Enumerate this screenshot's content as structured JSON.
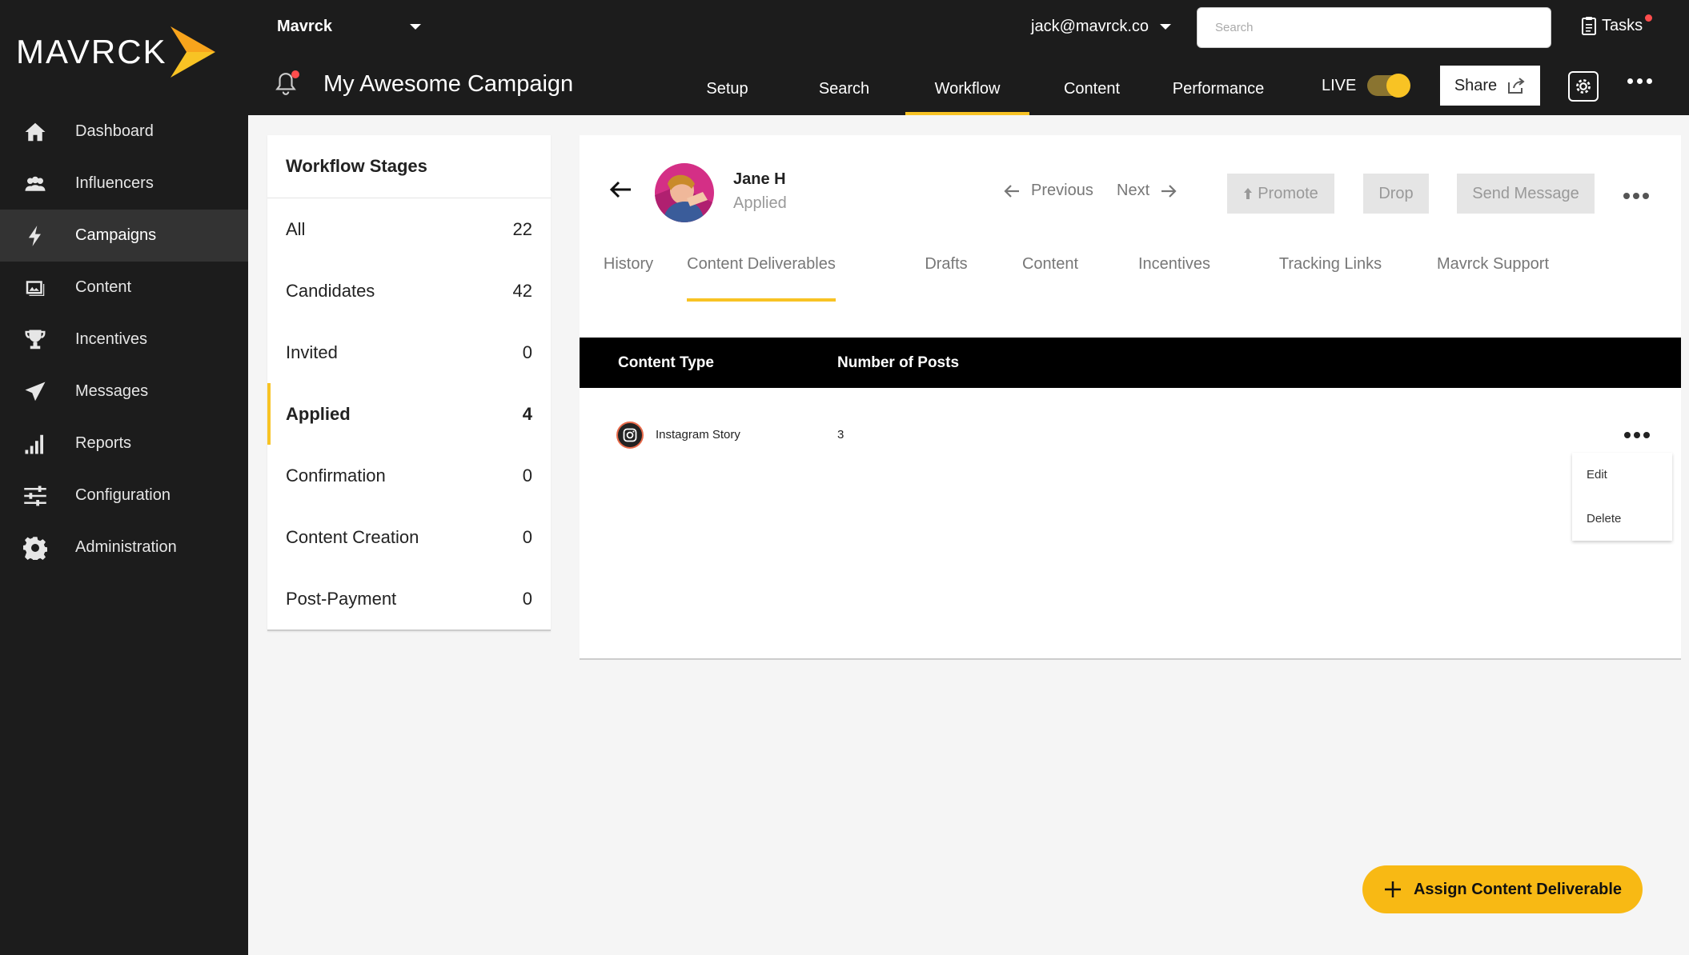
{
  "brand": {
    "name": "MAVRCK",
    "accent": "#f8c324"
  },
  "sidebar": {
    "items": [
      {
        "label": "Dashboard",
        "icon": "home-icon"
      },
      {
        "label": "Influencers",
        "icon": "people-icon"
      },
      {
        "label": "Campaigns",
        "icon": "lightning-icon",
        "active": true
      },
      {
        "label": "Content",
        "icon": "image-icon"
      },
      {
        "label": "Incentives",
        "icon": "trophy-icon"
      },
      {
        "label": "Messages",
        "icon": "send-icon"
      },
      {
        "label": "Reports",
        "icon": "bar-chart-icon"
      },
      {
        "label": "Configuration",
        "icon": "sliders-icon"
      },
      {
        "label": "Administration",
        "icon": "gear-icon"
      }
    ]
  },
  "topbar": {
    "org": "Mavrck",
    "user_email": "jack@mavrck.co",
    "search_placeholder": "Search",
    "tasks_label": "Tasks",
    "campaign_title": "My Awesome Campaign",
    "tabs": [
      "Setup",
      "Search",
      "Workflow",
      "Content",
      "Performance"
    ],
    "active_tab": "Workflow",
    "live_label": "LIVE",
    "live_on": true,
    "share_label": "Share"
  },
  "stages": {
    "title": "Workflow Stages",
    "items": [
      {
        "label": "All",
        "count": "22"
      },
      {
        "label": "Candidates",
        "count": "42"
      },
      {
        "label": "Invited",
        "count": "0"
      },
      {
        "label": "Applied",
        "count": "4",
        "active": true
      },
      {
        "label": "Confirmation",
        "count": "0"
      },
      {
        "label": "Content Creation",
        "count": "0"
      },
      {
        "label": "Post-Payment",
        "count": "0"
      }
    ]
  },
  "candidate": {
    "name": "Jane H",
    "status": "Applied",
    "previous_label": "Previous",
    "next_label": "Next",
    "promote_label": "Promote",
    "drop_label": "Drop",
    "message_label": "Send Message"
  },
  "sub_tabs": {
    "items": [
      "History",
      "Content Deliverables",
      "Drafts",
      "Content",
      "Incentives",
      "Tracking Links",
      "Mavrck Support"
    ],
    "active": "Content Deliverables"
  },
  "deliverables": {
    "headers": [
      "Content Type",
      "Number of Posts"
    ],
    "rows": [
      {
        "type": "Instagram Story",
        "posts": "3",
        "icon": "instagram-icon"
      }
    ],
    "menu": [
      "Edit",
      "Delete"
    ]
  },
  "fab_label": "Assign Content Deliverable"
}
